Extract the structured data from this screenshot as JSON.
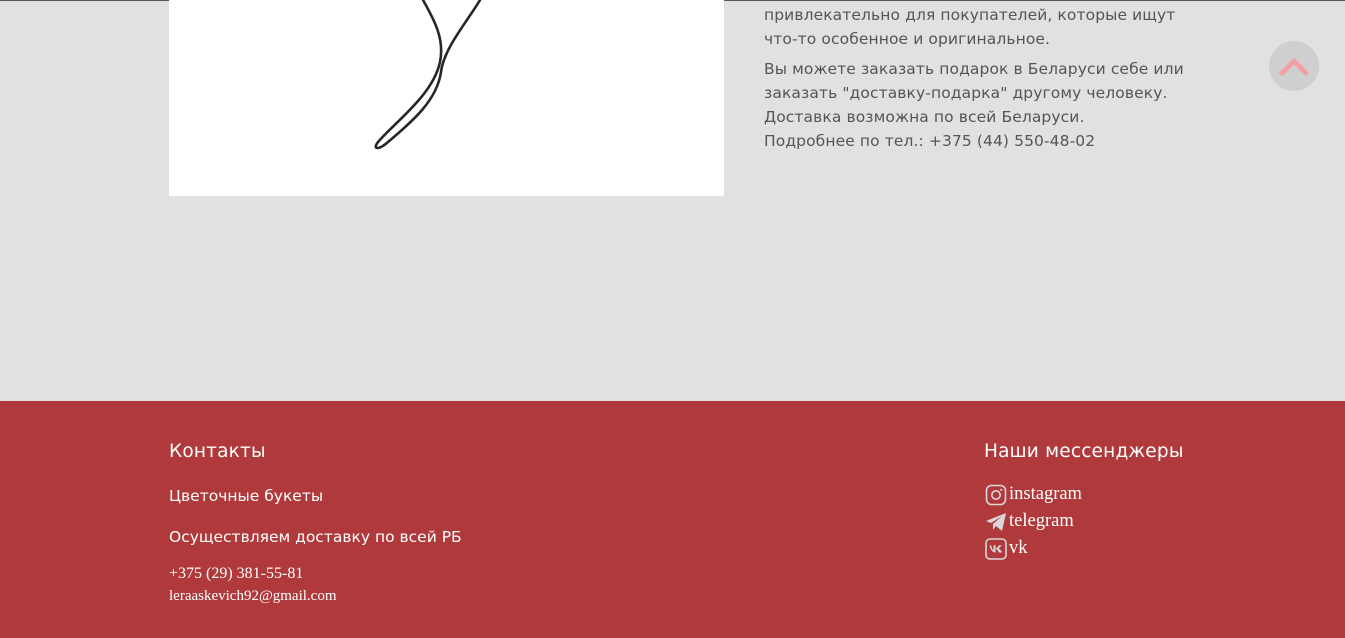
{
  "product": {
    "description_line1": "привлекательно для покупателей, которые ищут",
    "description_line2": "что-то особенное и оригинальное.",
    "order_line1": "Вы можете заказать подарок в Беларуси себе или",
    "order_line2": "заказать \"доставку-подарка\" другому человеку.",
    "order_line3": "Доставка возможна по всей Беларуси.",
    "order_line4": "Подробнее по тел.: +375 (44) 550-48-02"
  },
  "footer": {
    "contacts_heading": "Контакты",
    "shop_name": "Цветочные букеты",
    "delivery_text": "Осуществляем доставку по всей РБ",
    "phone": "+375 (29) 381-55-81",
    "email": "leraaskevich92@gmail.com",
    "messengers_heading": "Наши мессенджеры",
    "messengers": [
      {
        "label": "instagram",
        "icon": "instagram-icon"
      },
      {
        "label": "telegram",
        "icon": "telegram-icon"
      },
      {
        "label": "vk",
        "icon": "vk-icon"
      }
    ]
  },
  "colors": {
    "footer_bg": "#b0393b",
    "page_bg": "#e1e1e1",
    "scroll_arrow": "#f2a0a6"
  }
}
